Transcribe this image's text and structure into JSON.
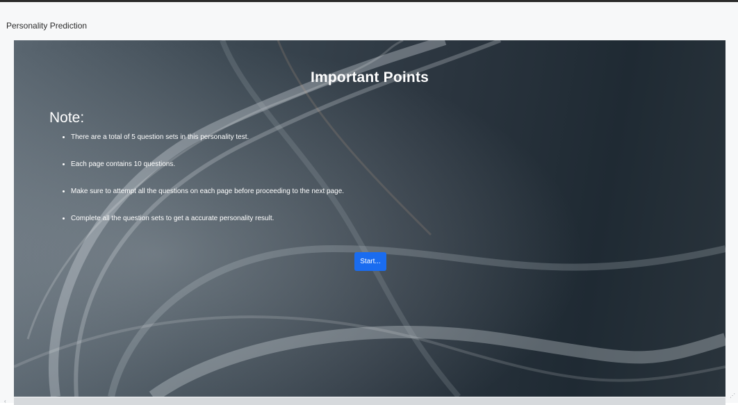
{
  "window": {
    "title": "Personality Prediction"
  },
  "main": {
    "heading": "Important Points",
    "note_label": "Note:",
    "points": [
      "There are a total of 5 question sets in this personality test.",
      "Each page contains 10 questions.",
      "Make sure to attempt all the questions on each page before proceeding to the next page.",
      "Complete all the question sets to get a accurate personality result."
    ],
    "start_label": "Start..."
  },
  "colors": {
    "button": "#1a6cf0",
    "text": "#ffffff",
    "window_border": "#2b2b2b"
  },
  "icons": {
    "resize": "resize-grip-icon"
  }
}
